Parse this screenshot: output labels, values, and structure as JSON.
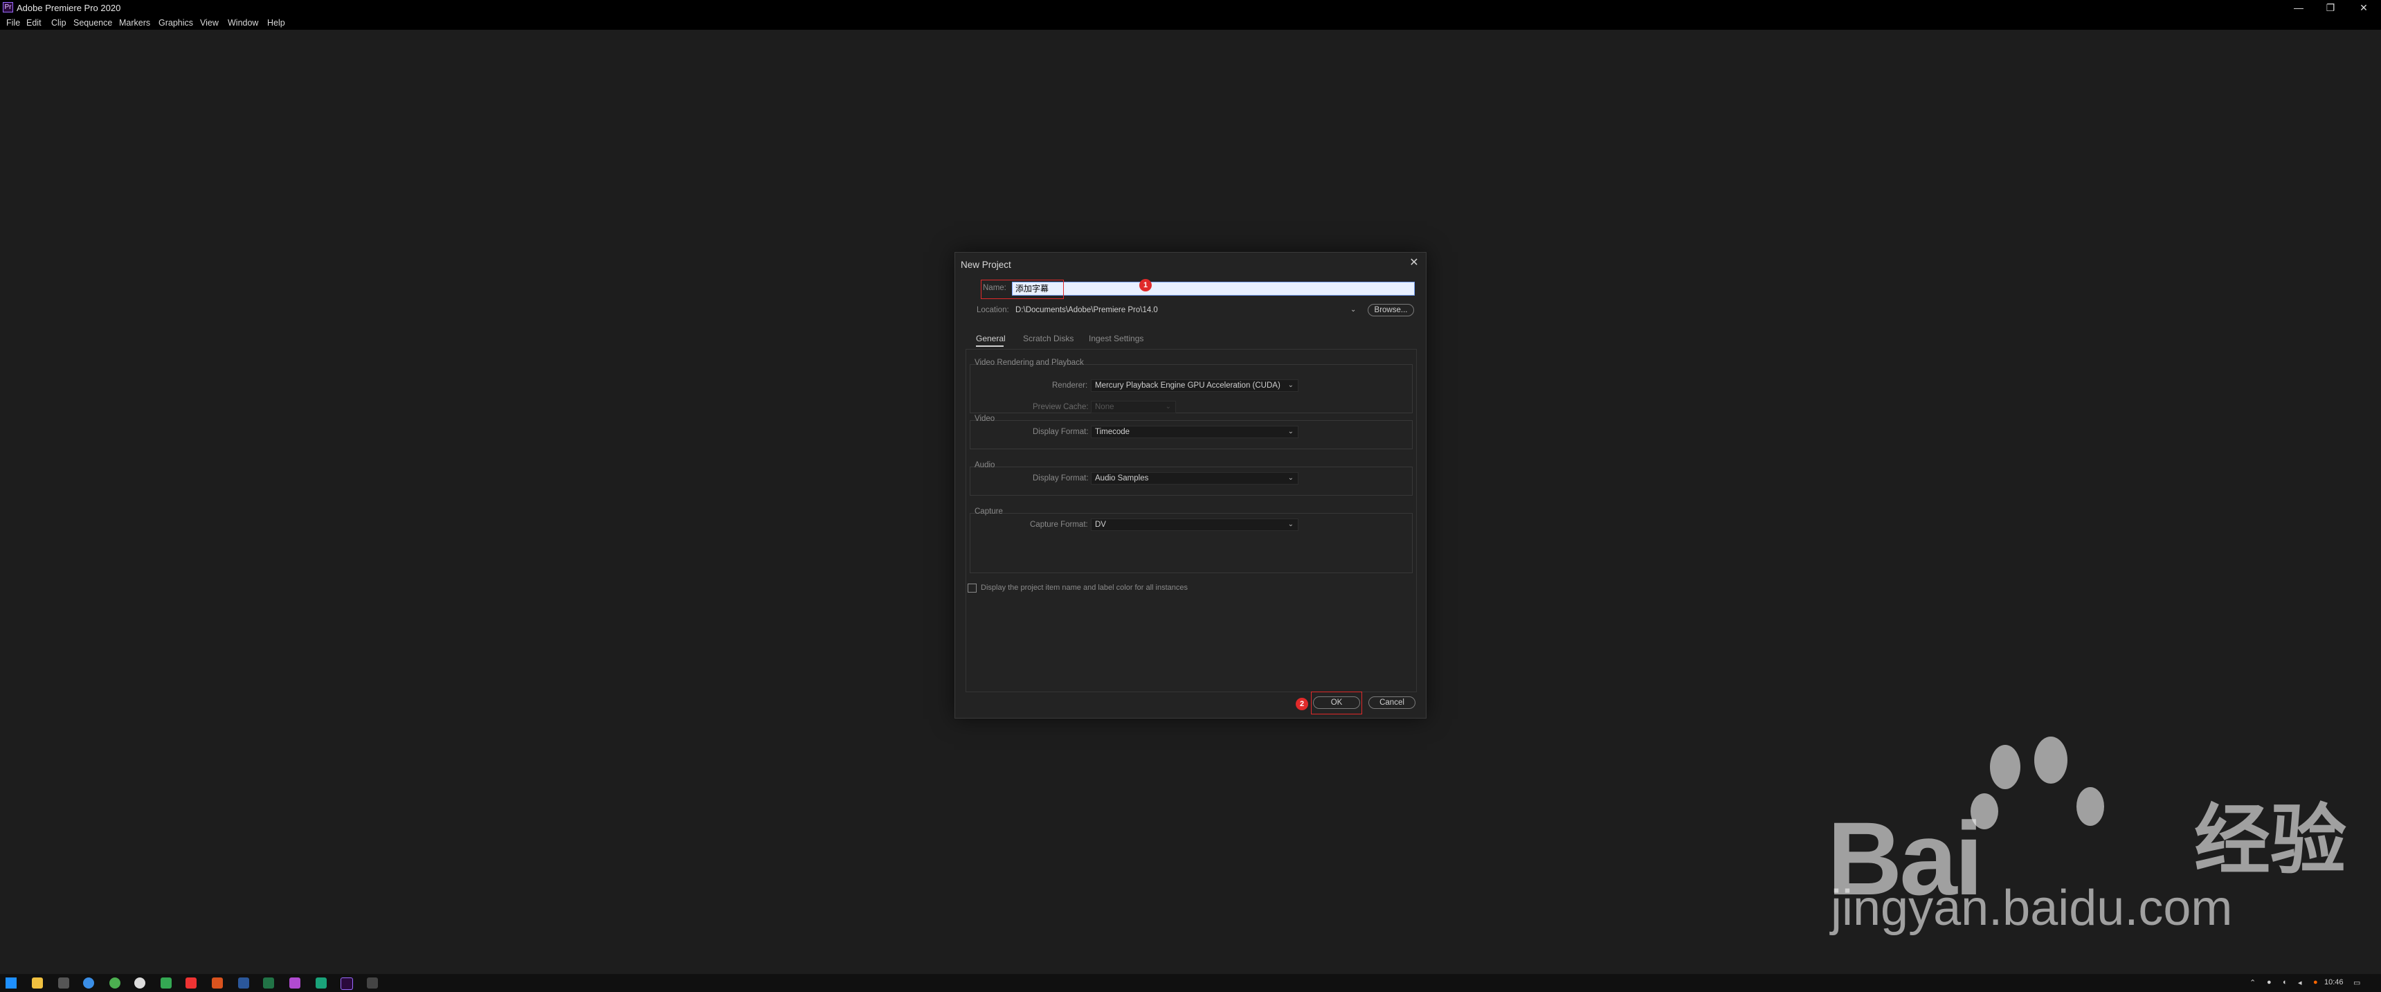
{
  "window": {
    "title": "Adobe Premiere Pro 2020",
    "app_icon": "Pr",
    "minimize": "—",
    "restore": "❐",
    "close": "✕"
  },
  "menu": [
    "File",
    "Edit",
    "Clip",
    "Sequence",
    "Markers",
    "Graphics",
    "View",
    "Window",
    "Help"
  ],
  "dialog": {
    "title": "New Project",
    "close": "✕",
    "name_label": "Name:",
    "name_value": "添加字幕",
    "location_label": "Location:",
    "location_value": "D:\\Documents\\Adobe\\Premiere Pro\\14.0",
    "browse": "Browse...",
    "tabs": [
      "General",
      "Scratch Disks",
      "Ingest Settings"
    ],
    "video_rendering": {
      "title": "Video Rendering and Playback",
      "renderer_label": "Renderer:",
      "renderer_value": "Mercury Playback Engine GPU Acceleration (CUDA)",
      "cache_label": "Preview Cache:",
      "cache_value": "None"
    },
    "video": {
      "title": "Video",
      "label": "Display Format:",
      "value": "Timecode"
    },
    "audio": {
      "title": "Audio",
      "label": "Display Format:",
      "value": "Audio Samples"
    },
    "capture": {
      "title": "Capture",
      "label": "Capture Format:",
      "value": "DV"
    },
    "checkbox_label": "Display the project item name and label color for all instances",
    "ok": "OK",
    "cancel": "Cancel"
  },
  "annotations": {
    "badge1": "1",
    "badge2": "2"
  },
  "taskbar": {
    "time": "10:46"
  },
  "watermark": {
    "brand": "Bai",
    "cn": "经验",
    "domain": "jingyan.baidu.com"
  }
}
